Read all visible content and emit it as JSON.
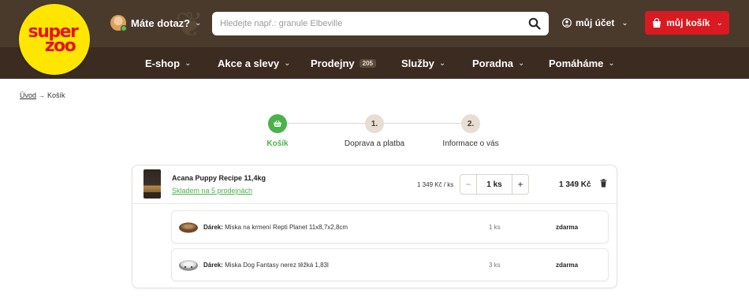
{
  "header": {
    "logo": {
      "line1": "super",
      "line2": "zoo"
    },
    "help_label": "Máte dotaz?",
    "search": {
      "placeholder": "Hledejte např.: granule Elbeville",
      "value": ""
    },
    "account_label": "můj účet",
    "cart_label": "můj košík"
  },
  "nav": {
    "items": [
      {
        "label": "E-shop",
        "has_dropdown": true
      },
      {
        "label": "Akce a slevy",
        "has_dropdown": true
      },
      {
        "label": "Prodejny",
        "badge": "205",
        "has_dropdown": false
      },
      {
        "label": "Služby",
        "has_dropdown": true
      },
      {
        "label": "Poradna",
        "has_dropdown": true
      },
      {
        "label": "Pomáháme",
        "has_dropdown": true
      }
    ]
  },
  "breadcrumb": {
    "home": "Úvod",
    "current": "Košík"
  },
  "steps": [
    {
      "marker": "",
      "label": "Košík",
      "active": true
    },
    {
      "marker": "1.",
      "label": "Doprava a platba",
      "active": false
    },
    {
      "marker": "2.",
      "label": "Informace o vás",
      "active": false
    }
  ],
  "cart": {
    "item": {
      "name": "Acana Puppy Recipe 11,4kg",
      "stock": "Skladem na 5 prodejnách",
      "unit_price": "1 349 Kč / ks",
      "qty_minus": "−",
      "qty_value": "1 ks",
      "qty_plus": "+",
      "total": "1 349 Kč"
    },
    "gifts": [
      {
        "prefix": "Dárek:",
        "name": "Miska na krmení Repti Planet 11x8,7x2,8cm",
        "qty": "1 ks",
        "price": "zdarma"
      },
      {
        "prefix": "Dárek:",
        "name": "Miska Dog Fantasy nerez těžká 1,83l",
        "qty": "3 ks",
        "price": "zdarma"
      }
    ]
  },
  "colors": {
    "header_brown": "#4a3a2c",
    "nav_brown": "#3b2b20",
    "brand_red": "#d91a21",
    "logo_yellow": "#ffe600",
    "accent_green": "#49b24a"
  }
}
